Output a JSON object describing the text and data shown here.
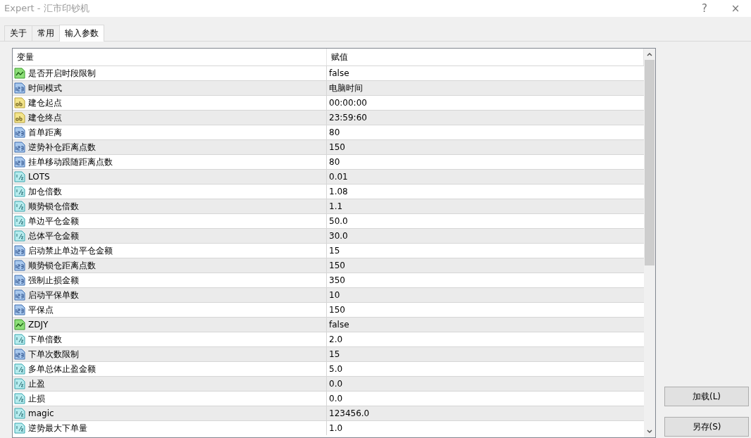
{
  "window": {
    "title": "Expert - 汇市印钞机",
    "help": "?",
    "close": "×"
  },
  "tabs": [
    {
      "label": "关于",
      "selected": false
    },
    {
      "label": "常用",
      "selected": false
    },
    {
      "label": "输入参数",
      "selected": true
    }
  ],
  "table": {
    "columns": [
      "变量",
      "赋值"
    ],
    "rows": [
      {
        "kind": "bool",
        "name": "是否开启时段限制",
        "value": "false"
      },
      {
        "kind": "int",
        "name": "时间模式",
        "value": "电脑时间"
      },
      {
        "kind": "string",
        "name": "建仓起点",
        "value": "00:00:00"
      },
      {
        "kind": "string",
        "name": "建仓终点",
        "value": "23:59:60"
      },
      {
        "kind": "int",
        "name": "首单距离",
        "value": "80"
      },
      {
        "kind": "int",
        "name": "逆势补仓距离点数",
        "value": "150"
      },
      {
        "kind": "int",
        "name": "挂单移动跟随距离点数",
        "value": "80"
      },
      {
        "kind": "double",
        "name": "LOTS",
        "value": "0.01"
      },
      {
        "kind": "double",
        "name": "加仓倍数",
        "value": "1.08"
      },
      {
        "kind": "double",
        "name": "顺势锁仓倍数",
        "value": "1.1"
      },
      {
        "kind": "double",
        "name": "单边平仓金额",
        "value": "50.0"
      },
      {
        "kind": "double",
        "name": "总体平仓金额",
        "value": "30.0"
      },
      {
        "kind": "int",
        "name": "启动禁止单边平仓金额",
        "value": "15"
      },
      {
        "kind": "int",
        "name": "顺势锁仓距离点数",
        "value": "150"
      },
      {
        "kind": "int",
        "name": "强制止损金额",
        "value": "350"
      },
      {
        "kind": "int",
        "name": "启动平保单数",
        "value": "10"
      },
      {
        "kind": "int",
        "name": "平保点",
        "value": "150"
      },
      {
        "kind": "bool",
        "name": "ZDJY",
        "value": "false"
      },
      {
        "kind": "double",
        "name": "下单倍数",
        "value": "2.0"
      },
      {
        "kind": "int",
        "name": "下单次数限制",
        "value": "15"
      },
      {
        "kind": "double",
        "name": "多单总体止盈金额",
        "value": "5.0"
      },
      {
        "kind": "double",
        "name": "止盈",
        "value": "0.0"
      },
      {
        "kind": "double",
        "name": "止损",
        "value": "0.0"
      },
      {
        "kind": "double",
        "name": "magic",
        "value": "123456.0"
      },
      {
        "kind": "double",
        "name": "逆势最大下单量",
        "value": "1.0"
      }
    ]
  },
  "buttons": [
    "加载(L)",
    "另存(S)"
  ]
}
